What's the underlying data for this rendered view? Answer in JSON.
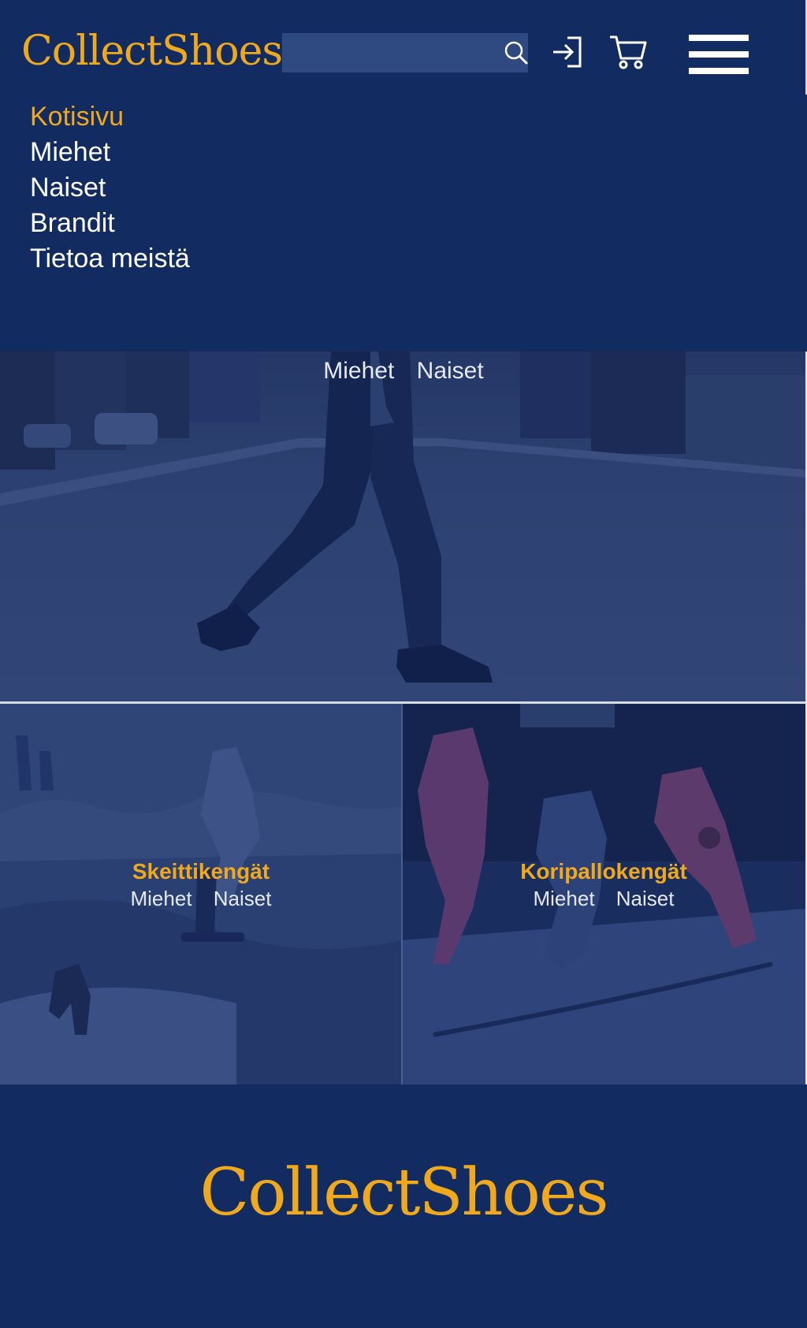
{
  "header": {
    "logo": "CollectShoes",
    "search": {
      "placeholder": "",
      "value": "",
      "icon": "search-icon"
    },
    "login_icon": "login-icon",
    "cart_icon": "cart-icon",
    "menu_icon": "menu-icon"
  },
  "menu": {
    "items": [
      {
        "label": "Kotisivu",
        "active": true
      },
      {
        "label": "Miehet",
        "active": false
      },
      {
        "label": "Naiset",
        "active": false
      },
      {
        "label": "Brandit",
        "active": false
      },
      {
        "label": "Tietoa meistä",
        "active": false
      }
    ]
  },
  "hero": {
    "links": {
      "men": "Miehet",
      "women": "Naiset"
    }
  },
  "categories": [
    {
      "title": "Skeittikengät",
      "men": "Miehet",
      "women": "Naiset"
    },
    {
      "title": "Koripallokengät",
      "men": "Miehet",
      "women": "Naiset"
    }
  ],
  "footer": {
    "logo": "CollectShoes"
  },
  "colors": {
    "navy": "#122c62",
    "gold": "#f0a81c",
    "search_bg": "#2e4a80",
    "white": "#ffffff"
  }
}
